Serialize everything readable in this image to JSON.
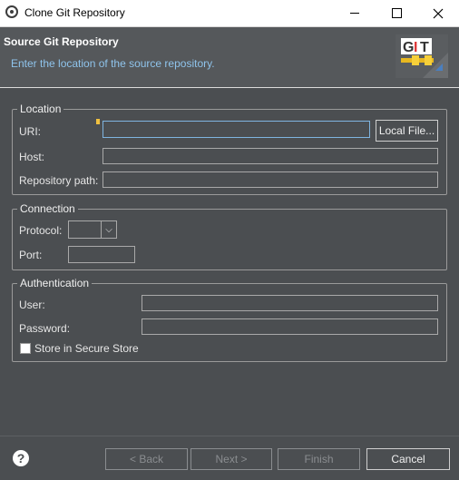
{
  "window": {
    "title": "Clone Git Repository",
    "icon": "eclipse-icon",
    "controls": [
      "minimize-icon",
      "maximize-icon",
      "close-icon"
    ]
  },
  "header": {
    "title": "Source Git Repository",
    "description": "Enter the location of the source repository.",
    "logo_text": "GIT"
  },
  "location": {
    "legend": "Location",
    "uri_label": "URI:",
    "uri_value": "",
    "local_file_button": "Local File...",
    "host_label": "Host:",
    "host_value": "",
    "repo_path_label": "Repository path:",
    "repo_path_value": ""
  },
  "connection": {
    "legend": "Connection",
    "protocol_label": "Protocol:",
    "protocol_value": "",
    "port_label": "Port:",
    "port_value": ""
  },
  "authentication": {
    "legend": "Authentication",
    "user_label": "User:",
    "user_value": "",
    "password_label": "Password:",
    "password_value": "",
    "secure_store_label": "Store in Secure Store",
    "secure_store_checked": false
  },
  "footer": {
    "back": "< Back",
    "next": "Next >",
    "finish": "Finish",
    "cancel": "Cancel"
  },
  "colors": {
    "background": "#4b4e51",
    "header_background": "#55585b",
    "description_text": "#8fc4ec",
    "focus_border": "#7fb4e0"
  }
}
